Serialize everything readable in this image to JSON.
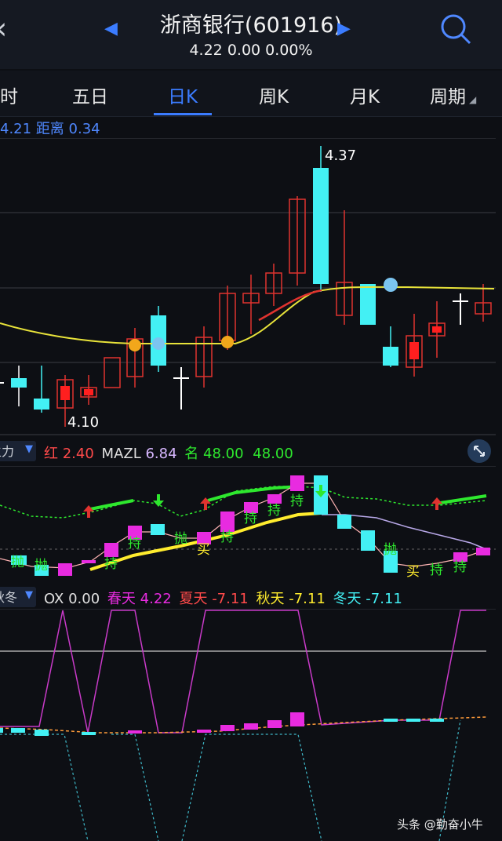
{
  "header": {
    "title": "浙商银行(601916)",
    "quote": "4.22 0.00 0.00%",
    "back_icon": "chevron-left-icon",
    "prev_icon": "triangle-left-icon",
    "next_icon": "triangle-right-icon",
    "search_icon": "search-icon"
  },
  "tabs": [
    {
      "label": "时"
    },
    {
      "label": "五日"
    },
    {
      "label": "日K",
      "active": true
    },
    {
      "label": "周K"
    },
    {
      "label": "月K"
    },
    {
      "label": "周期"
    }
  ],
  "main_chart": {
    "legend_value": "4.21",
    "legend_label": "距离",
    "legend_dist": "0.34",
    "high_label": "4.37",
    "low_label": "4.10"
  },
  "indicator1": {
    "selector": "主力",
    "red_label": "红",
    "red_value": "2.40",
    "mazl_label": "MAZL",
    "mazl_value": "6.84",
    "ming_label": "名",
    "ming_value1": "48.00",
    "ming_value2": "48.00",
    "signals": [
      "抛",
      "抛",
      "持",
      "抛",
      "买",
      "持",
      "持",
      "持",
      "持",
      "抛",
      "买",
      "持",
      "持",
      "持"
    ]
  },
  "indicator2": {
    "selector": "秋冬",
    "ox_label": "OX",
    "ox_value": "0.00",
    "spring_label": "春天",
    "spring_value": "4.22",
    "summer_label": "夏天",
    "summer_value": "-7.11",
    "autumn_label": "秋天",
    "autumn_value": "-7.11",
    "winter_label": "冬天",
    "winter_value": "-7.11"
  },
  "colors": {
    "up": "#e0332f",
    "down": "#43f0f4",
    "ma": "#e8e33a",
    "accent": "#3b7cff",
    "magenta": "#e82be0",
    "green": "#2ee82e"
  },
  "watermark": "头条 @勤奋小牛"
}
